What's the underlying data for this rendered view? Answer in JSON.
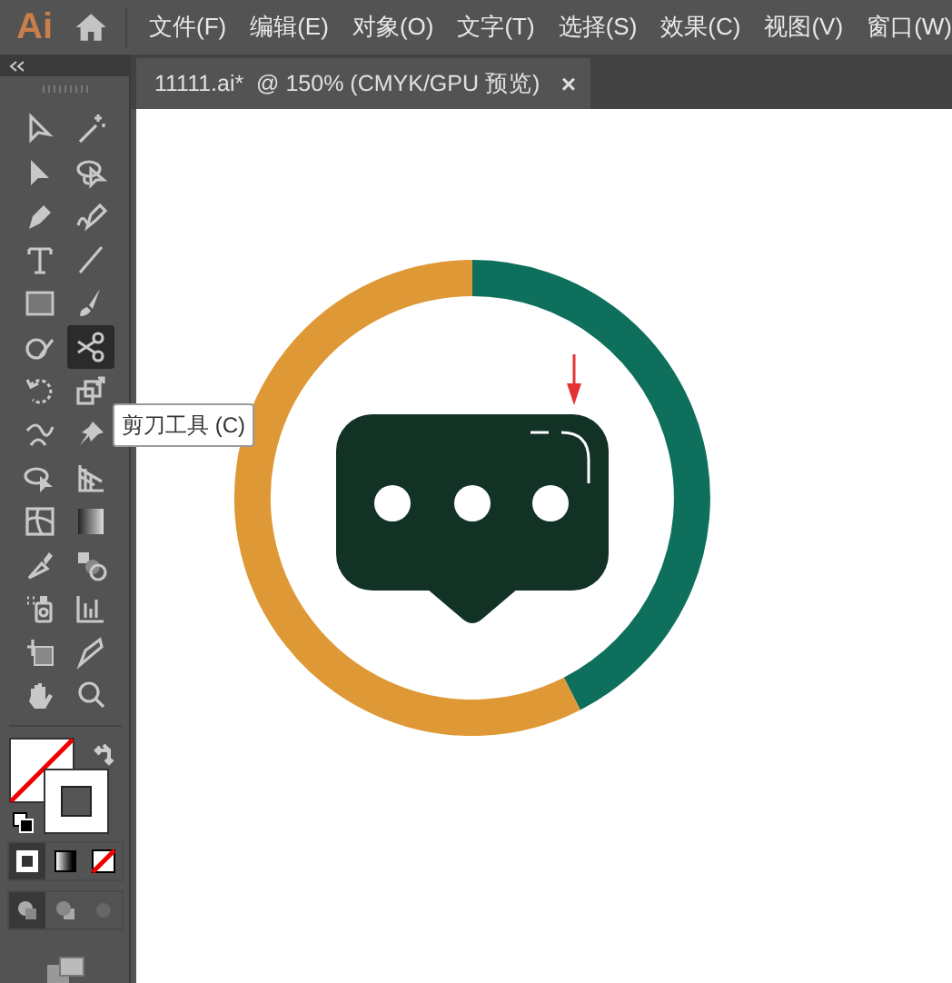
{
  "app": {
    "logo": "Ai"
  },
  "menu": [
    "文件(F)",
    "编辑(E)",
    "对象(O)",
    "文字(T)",
    "选择(S)",
    "效果(C)",
    "视图(V)",
    "窗口(W)"
  ],
  "document_tab": {
    "title": "11111.ai*  @ 150% (CMYK/GPU 预览)",
    "close": "×"
  },
  "tools": [
    {
      "selected": false
    },
    {
      "selected": false
    },
    {
      "selected": false
    },
    {
      "selected": false
    },
    {
      "selected": false
    },
    {
      "selected": false
    },
    {
      "selected": false
    },
    {
      "selected": false
    },
    {
      "selected": false
    },
    {
      "selected": false
    },
    {
      "selected": false
    },
    {
      "selected": true
    },
    {
      "selected": false
    },
    {
      "selected": false
    },
    {
      "selected": false
    },
    {
      "selected": false
    },
    {
      "selected": false
    },
    {
      "selected": false
    },
    {
      "selected": false
    },
    {
      "selected": false
    },
    {
      "selected": false
    },
    {
      "selected": false
    },
    {
      "selected": false
    },
    {
      "selected": false
    },
    {
      "selected": false
    },
    {
      "selected": false
    },
    {
      "selected": false
    },
    {
      "selected": false
    }
  ],
  "tooltip": "剪刀工具 (C)"
}
